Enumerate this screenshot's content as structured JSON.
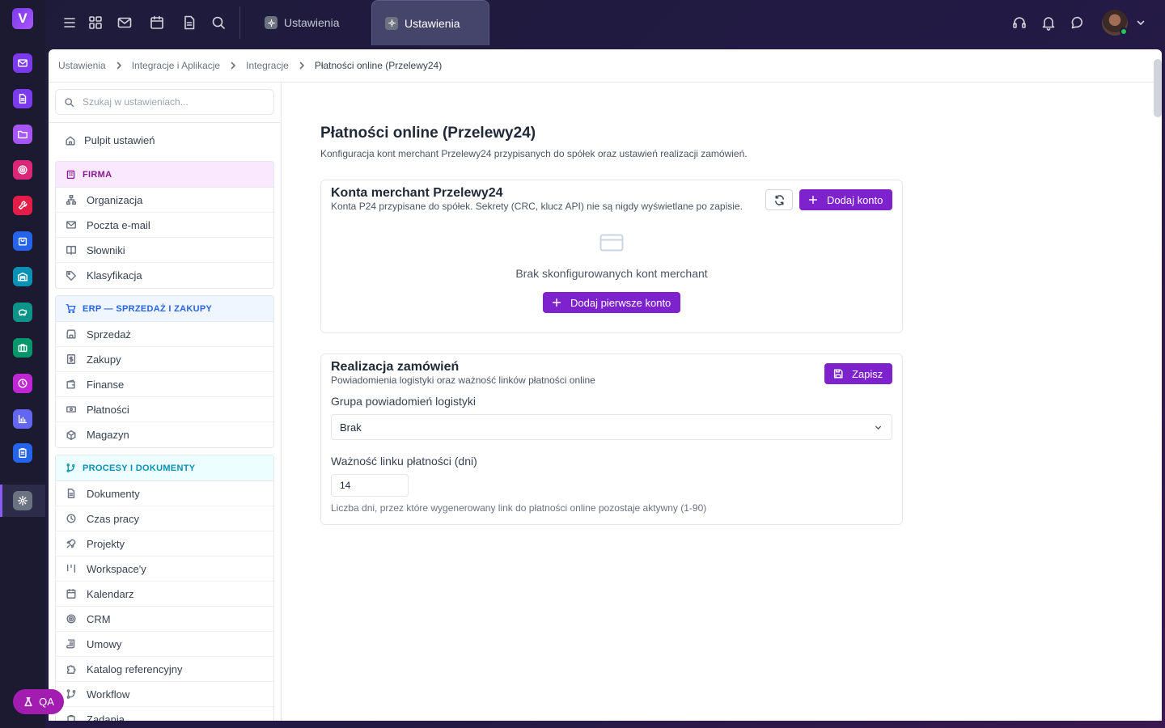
{
  "app": {
    "logo_letter": "V",
    "qa_label": "QA"
  },
  "rail": {
    "items": [
      {
        "name": "mail",
        "color": "#7c3aed"
      },
      {
        "name": "document",
        "color": "#7c3aed"
      },
      {
        "name": "folder",
        "color": "#a855f7"
      },
      {
        "name": "target",
        "color": "#db2777"
      },
      {
        "name": "wrench",
        "color": "#e11d48"
      },
      {
        "name": "bag",
        "color": "#2563eb"
      },
      {
        "name": "warehouse",
        "color": "#0891b2"
      },
      {
        "name": "piggy-bank",
        "color": "#0d9488"
      },
      {
        "name": "briefcase",
        "color": "#059669"
      },
      {
        "name": "clock",
        "color": "#c026d3"
      },
      {
        "name": "chart",
        "color": "#6366f1"
      },
      {
        "name": "clipboard",
        "color": "#2563eb"
      }
    ],
    "active": "settings"
  },
  "topbar": {
    "tabs": [
      {
        "label": "Ustawienia",
        "active": false
      },
      {
        "label": "Ustawienia",
        "active": true
      }
    ]
  },
  "breadcrumb": [
    "Ustawienia",
    "Integracje i Aplikacje",
    "Integracje",
    "Płatności online (Przelewy24)"
  ],
  "sidebar": {
    "search_placeholder": "Szukaj w ustawieniach...",
    "home_label": "Pulpit ustawień",
    "groups": [
      {
        "title": "FIRMA",
        "color": "#86198f",
        "bg": "#fae8ff",
        "items": [
          "Organizacja",
          "Poczta e-mail",
          "Słowniki",
          "Klasyfikacja"
        ]
      },
      {
        "title": "ERP — SPRZEDAŻ I ZAKUPY",
        "color": "#2563eb",
        "bg": "#eff6ff",
        "items": [
          "Sprzedaż",
          "Zakupy",
          "Finanse",
          "Płatności",
          "Magazyn"
        ]
      },
      {
        "title": "PROCESY I DOKUMENTY",
        "color": "#0891b2",
        "bg": "#ecfeff",
        "items": [
          "Dokumenty",
          "Czas pracy",
          "Projekty",
          "Workspace'y",
          "Kalendarz",
          "CRM",
          "Umowy",
          "Katalog referencyjny",
          "Workflow",
          "Zadania"
        ]
      }
    ]
  },
  "main": {
    "title": "Płatności online (Przelewy24)",
    "subtitle": "Konfiguracja kont merchant Przelewy24 przypisanych do spółek oraz ustawień realizacji zamówień.",
    "merchant_card": {
      "title": "Konta merchant Przelewy24",
      "subtitle": "Konta P24 przypisane do spółek. Sekrety (CRC, klucz API) nie są nigdy wyświetlane po zapisie.",
      "add_button": "Dodaj konto",
      "empty_text": "Brak skonfigurowanych kont merchant",
      "add_first_button": "Dodaj pierwsze konto"
    },
    "fulfillment_card": {
      "title": "Realizacja zamówień",
      "subtitle": "Powiadomienia logistyki oraz ważność linków płatności online",
      "save_button": "Zapisz",
      "group_label": "Grupa powiadomień logistyki",
      "group_value": "Brak",
      "validity_label": "Ważność linku płatności (dni)",
      "validity_value": "14",
      "validity_hint": "Liczba dni, przez które wygenerowany link do płatności online pozostaje aktywny (1-90)"
    }
  },
  "colors": {
    "accent": "#7e22ce",
    "rail_bg": "#1b1a30"
  }
}
